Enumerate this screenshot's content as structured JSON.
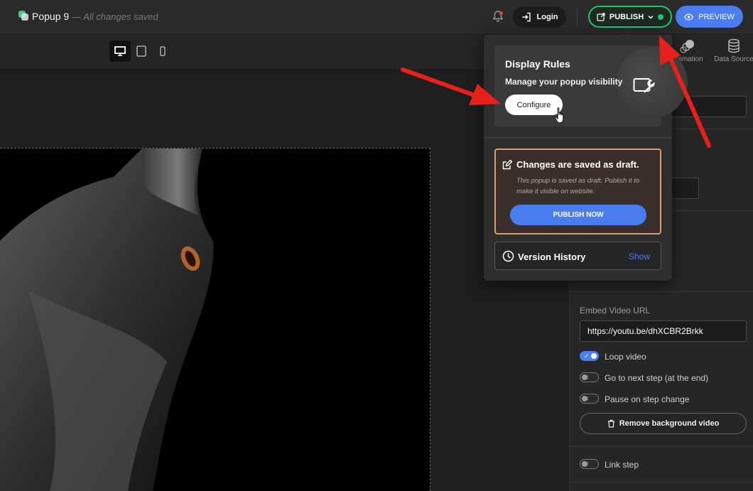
{
  "header": {
    "title": "Popup 9",
    "saved_status": "— All changes saved",
    "login_label": "Login",
    "publish_label": "PUBLISH",
    "preview_label": "PREVIEW"
  },
  "toolbar": {
    "devices": [
      "desktop-icon",
      "tablet-icon",
      "mobile-icon"
    ],
    "tabs": [
      {
        "label": "Animation"
      },
      {
        "label": "Data Source"
      }
    ]
  },
  "popup": {
    "display_rules": {
      "title": "Display Rules",
      "subtitle": "Manage your popup visibility",
      "configure_label": "Configure"
    },
    "draft": {
      "title": "Changes are saved as draft.",
      "text": "This popup is saved as draft. Publish it to make it visible on website.",
      "publish_now_label": "PUBLISH NOW"
    },
    "version_history": {
      "title": "Version History",
      "show_label": "Show"
    }
  },
  "right_panel": {
    "embed_label": "Embed Video URL",
    "embed_value": "https://youtu.be/dhXCBR2Brkk",
    "toggles": [
      {
        "label": "Loop video",
        "on": true
      },
      {
        "label": "Go to next step (at the end)",
        "on": false
      },
      {
        "label": "Pause on step change",
        "on": false
      }
    ],
    "remove_bg_label": "Remove background video",
    "link_step": {
      "label": "Link step",
      "on": false
    }
  },
  "colors": {
    "accent_blue": "#4a7df0",
    "publish_green": "#20c46b",
    "draft_border": "#d9a06b",
    "arrow_red": "#e8201c"
  }
}
